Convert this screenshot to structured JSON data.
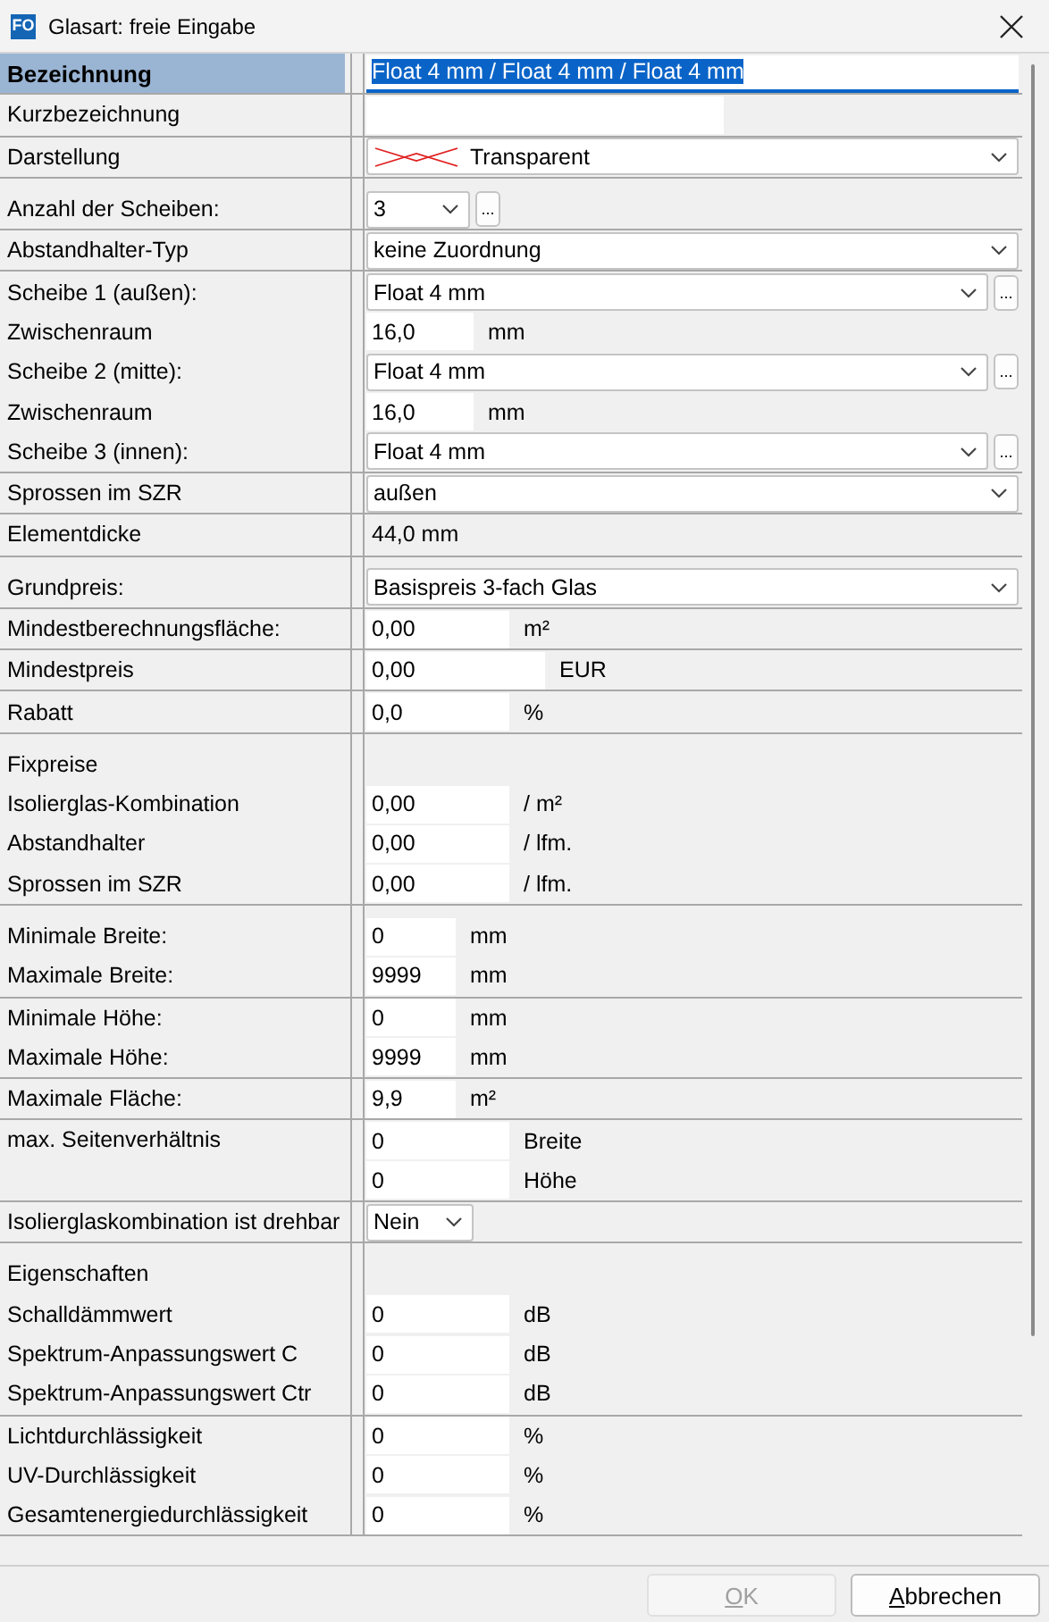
{
  "window": {
    "app_badge": "FO",
    "title": "Glasart: freie Eingabe"
  },
  "groups": [
    {
      "rows": [
        {
          "label": "Bezeichnung",
          "selected": true,
          "kind": "text",
          "value": "Float 4 mm / Float 4 mm / Float 4 mm",
          "value_selected": true
        }
      ]
    },
    {
      "rows": [
        {
          "label": "Kurzbezeichnung",
          "selected": false,
          "kind": "short_text"
        }
      ]
    },
    {
      "rows": [
        {
          "label": "Darstellung",
          "selected": false,
          "kind": "pattern_dropdown",
          "value": "Transparent"
        }
      ]
    },
    {
      "rows": [
        {
          "label": "Anzahl der Scheiben:",
          "selected": false,
          "kind": "count_dropdown",
          "value": "3",
          "more": "..."
        }
      ]
    },
    {
      "rows": [
        {
          "label": "Abstandhalter-Typ",
          "selected": false,
          "kind": "dropdown",
          "value": "keine Zuordnung"
        }
      ]
    },
    {
      "rows": [
        {
          "label": "Scheibe 1 (außen):",
          "selected": false,
          "kind": "dropdown_more",
          "value": "Float 4 mm",
          "more": "..."
        },
        {
          "label": "Zwischenraum",
          "selected": false,
          "kind": "spacing",
          "value": "16,0",
          "unit": "mm"
        },
        {
          "label": "Scheibe 2 (mitte):",
          "selected": false,
          "kind": "dropdown_more",
          "value": "Float 4 mm",
          "more": "..."
        },
        {
          "label": "Zwischenraum",
          "selected": false,
          "kind": "spacing",
          "value": "16,0",
          "unit": "mm"
        },
        {
          "label": "Scheibe 3 (innen):",
          "selected": false,
          "kind": "dropdown_more",
          "value": "Float 4 mm",
          "more": "..."
        }
      ]
    },
    {
      "rows": [
        {
          "label": "Sprossen im SZR",
          "selected": false,
          "kind": "dropdown",
          "value": "außen"
        }
      ]
    },
    {
      "rows": [
        {
          "label": "Elementdicke",
          "selected": false,
          "kind": "static",
          "value": "44,0 mm"
        }
      ]
    },
    {
      "rows": [
        {
          "label": "Grundpreis:",
          "selected": false,
          "kind": "dropdown",
          "value": "Basispreis 3-fach Glas"
        }
      ]
    },
    {
      "rows": [
        {
          "label": "Mindestberechnungsfläche:",
          "selected": false,
          "kind": "amount",
          "value": "0,00",
          "unit": "m²"
        }
      ]
    },
    {
      "rows": [
        {
          "label": "Mindestpreis",
          "selected": false,
          "kind": "price",
          "value": "0,00",
          "unit": "EUR"
        }
      ]
    },
    {
      "rows": [
        {
          "label": "Rabatt",
          "selected": false,
          "kind": "amount",
          "value": "0,0",
          "unit": "%"
        }
      ]
    },
    {
      "rows": [
        {
          "label": "Fixpreise",
          "selected": false,
          "kind": "heading"
        },
        {
          "label": "Isolierglas-Kombination",
          "selected": false,
          "kind": "amount",
          "value": "0,00",
          "unit": "/ m²"
        },
        {
          "label": "Abstandhalter",
          "selected": false,
          "kind": "amount",
          "value": "0,00",
          "unit": "/ lfm."
        },
        {
          "label": "Sprossen im SZR",
          "selected": false,
          "kind": "amount",
          "value": "0,00",
          "unit": "/ lfm."
        }
      ]
    },
    {
      "rows": [
        {
          "label": "Minimale Breite:",
          "selected": false,
          "kind": "dimension",
          "value": "0",
          "unit": "mm"
        },
        {
          "label": "Maximale Breite:",
          "selected": false,
          "kind": "dimension",
          "value": "9999",
          "unit": "mm"
        }
      ]
    },
    {
      "rows": [
        {
          "label": "Minimale Höhe:",
          "selected": false,
          "kind": "dimension",
          "value": "0",
          "unit": "mm"
        },
        {
          "label": "Maximale Höhe:",
          "selected": false,
          "kind": "dimension",
          "value": "9999",
          "unit": "mm"
        }
      ]
    },
    {
      "rows": [
        {
          "label": "Maximale Fläche:",
          "selected": false,
          "kind": "dimension",
          "value": "9,9",
          "unit": "m²"
        }
      ]
    },
    {
      "rows": [
        {
          "label": "max. Seitenverhältnis",
          "selected": false,
          "kind": "ratio",
          "fields": [
            {
              "value": "0",
              "unit": "Breite"
            },
            {
              "value": "0",
              "unit": "Höhe"
            }
          ]
        }
      ]
    },
    {
      "rows": [
        {
          "label": "Isolierglaskombination ist drehbar",
          "selected": false,
          "kind": "small_dropdown",
          "value": "Nein"
        }
      ]
    },
    {
      "rows": [
        {
          "label": "Eigenschaften",
          "selected": false,
          "kind": "heading"
        },
        {
          "label": "Schalldämmwert",
          "selected": false,
          "kind": "amount",
          "value": "0",
          "unit": "dB"
        },
        {
          "label": "Spektrum-Anpassungswert C",
          "selected": false,
          "kind": "amount",
          "value": "0",
          "unit": "dB"
        },
        {
          "label": "Spektrum-Anpassungswert Ctr",
          "selected": false,
          "kind": "amount",
          "value": "0",
          "unit": "dB"
        }
      ]
    },
    {
      "rows": [
        {
          "label": "Lichtdurchlässigkeit",
          "selected": false,
          "kind": "amount",
          "value": "0",
          "unit": "%"
        },
        {
          "label": "UV-Durchlässigkeit",
          "selected": false,
          "kind": "amount",
          "value": "0",
          "unit": "%"
        },
        {
          "label": "Gesamtenergiedurchlässigkeit",
          "selected": false,
          "kind": "amount",
          "value": "0",
          "unit": "%"
        }
      ]
    }
  ],
  "buttons": [
    {
      "label": "OK",
      "disabled": true
    },
    {
      "label": "Abbrechen",
      "disabled": false
    }
  ]
}
